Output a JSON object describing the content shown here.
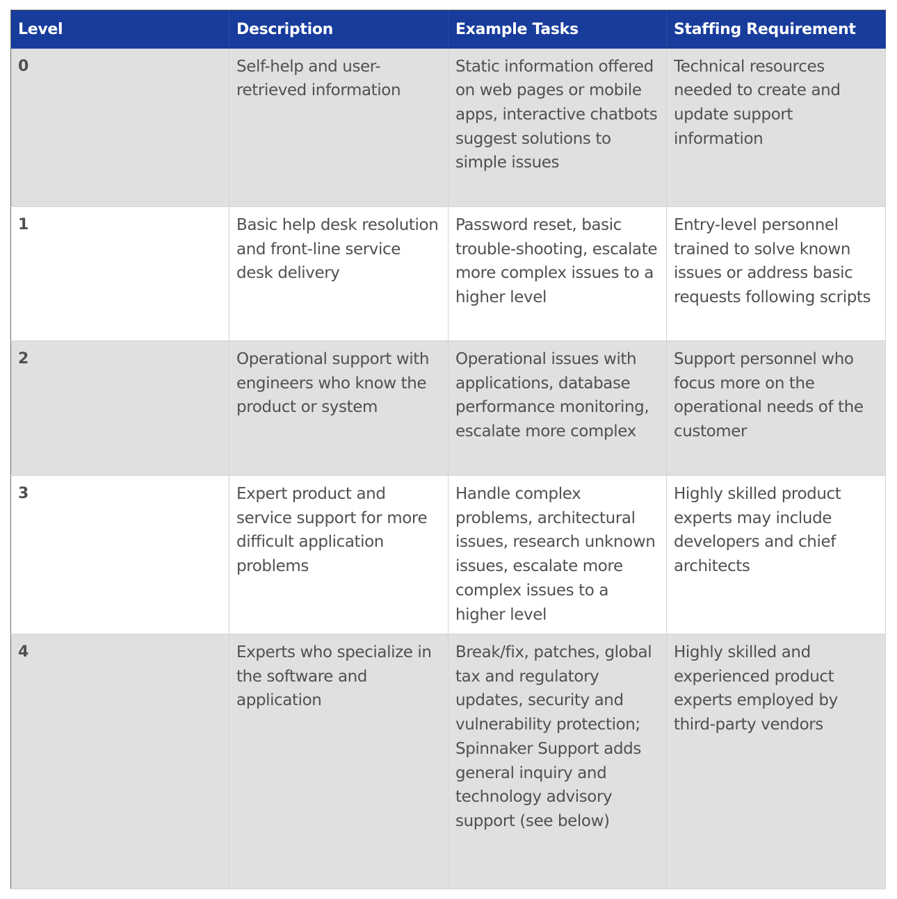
{
  "table": {
    "header_color": "#173c9c",
    "headers": [
      "Level",
      "Description",
      "Example Tasks",
      "Staffing Requirement"
    ],
    "rows": [
      {
        "level": "0",
        "description": "Self-help and user-retrieved information",
        "example_tasks": "Static information offered on web pages or mobile apps, interactive chatbots suggest solutions to simple issues",
        "staffing": "Technical resources needed to create and update support information"
      },
      {
        "level": "1",
        "description": "Basic help desk resolution and front-line service desk delivery",
        "example_tasks": "Password reset, basic trouble-shooting, escalate more complex issues to a higher level",
        "staffing": "Entry-level personnel trained to solve known issues or address basic requests following scripts"
      },
      {
        "level": "2",
        "description": "Operational support with engineers who know the product or system",
        "example_tasks": "Operational issues with applications, database performance monitoring, escalate more complex",
        "staffing": "Support personnel who focus more on the operational needs of the customer"
      },
      {
        "level": "3",
        "description": "Expert product and service support for more difficult application problems",
        "example_tasks": "Handle complex problems, architectural issues, research unknown issues, escalate more complex issues to a higher level",
        "staffing": "Highly skilled product experts may include developers and chief architects"
      },
      {
        "level": "4",
        "description": "Experts who specialize in the software and application",
        "example_tasks": "Break/fix, patches, global tax and regulatory updates, security and vulnerability protection; Spinnaker Support adds general inquiry and technology advisory support (see below)",
        "staffing": "Highly skilled and experienced product experts employed by third-party vendors"
      }
    ]
  }
}
